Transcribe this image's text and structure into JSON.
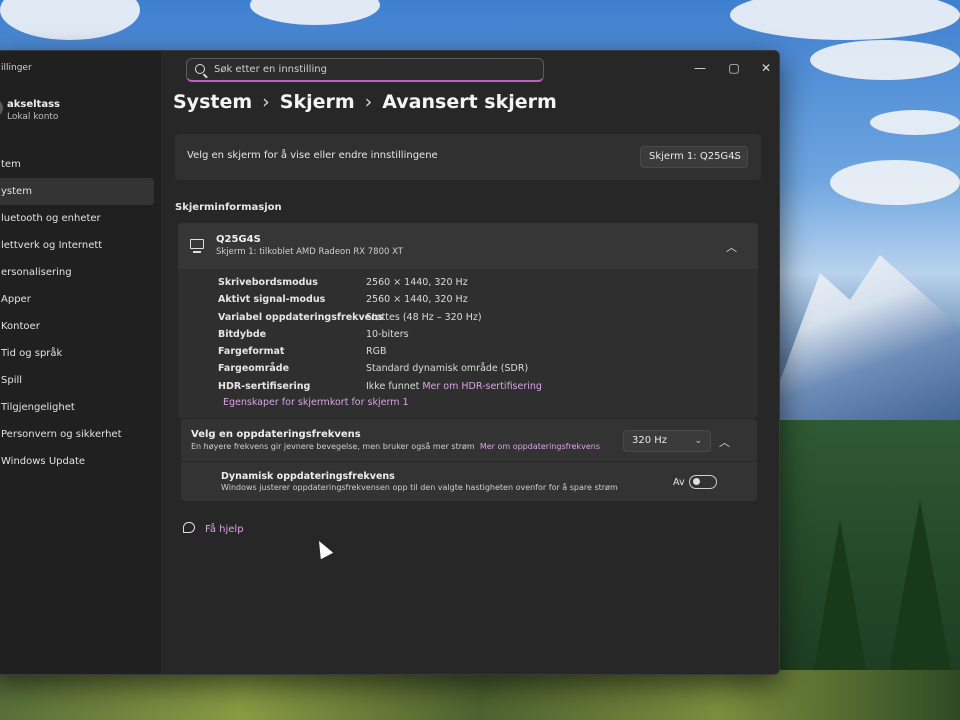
{
  "app": {
    "title": "illinger",
    "user_name": "akseltass",
    "user_account": "Lokal konto"
  },
  "search": {
    "value": "Søk etter en innstilling"
  },
  "window_controls": {
    "minimize": "—",
    "maximize": "▢",
    "close": "✕"
  },
  "sidebar": {
    "items": [
      {
        "label": "tem"
      },
      {
        "label": "ystem",
        "active": true
      },
      {
        "label": "luetooth og enheter"
      },
      {
        "label": "lettverk og Internett"
      },
      {
        "label": "ersonalisering"
      },
      {
        "label": "Apper"
      },
      {
        "label": "Kontoer"
      },
      {
        "label": "Tid og språk"
      },
      {
        "label": "Spill"
      },
      {
        "label": "Tilgjengelighet"
      },
      {
        "label": "Personvern og sikkerhet"
      },
      {
        "label": "Windows Update"
      }
    ]
  },
  "breadcrumb": {
    "level1": "System",
    "level2": "Skjerm",
    "level3": "Avansert skjerm",
    "separator": "›"
  },
  "display_select": {
    "label": "Velg en skjerm for å vise eller endre innstillingene",
    "value": "Skjerm 1: Q25G4S"
  },
  "display_info": {
    "section_title": "Skjerminformasjon",
    "monitor_name": "Q25G4S",
    "monitor_sub": "Skjerm 1: tilkoblet AMD Radeon RX 7800 XT",
    "rows": [
      {
        "key": "Skrivebordsmodus",
        "value": "2560 × 1440, 320 Hz"
      },
      {
        "key": "Aktivt signal-modus",
        "value": "2560 × 1440, 320 Hz"
      },
      {
        "key": "Variabel oppdateringsfrekvens",
        "value": "Støttes (48 Hz – 320 Hz)"
      },
      {
        "key": "Bitdybde",
        "value": "10-biters"
      },
      {
        "key": "Fargeformat",
        "value": "RGB"
      },
      {
        "key": "Fargeområde",
        "value": "Standard dynamisk område (SDR)"
      },
      {
        "key": "HDR-sertifisering",
        "value": "Ikke funnet",
        "link": "Mer om HDR-sertifisering"
      }
    ],
    "adapter_link": "Egenskaper for skjermkort for skjerm 1"
  },
  "refresh_rate": {
    "title": "Velg en oppdateringsfrekvens",
    "subtitle": "En høyere frekvens gir jevnere bevegelse, men bruker også mer strøm",
    "link": "Mer om oppdateringsfrekvens",
    "value": "320 Hz",
    "dynamic_title": "Dynamisk oppdateringsfrekvens",
    "dynamic_sub": "Windows justerer oppdateringsfrekvensen opp til den valgte hastigheten ovenfor for å spare strøm",
    "toggle_label": "Av",
    "toggle_on": false
  },
  "help": {
    "label": "Få hjelp"
  }
}
